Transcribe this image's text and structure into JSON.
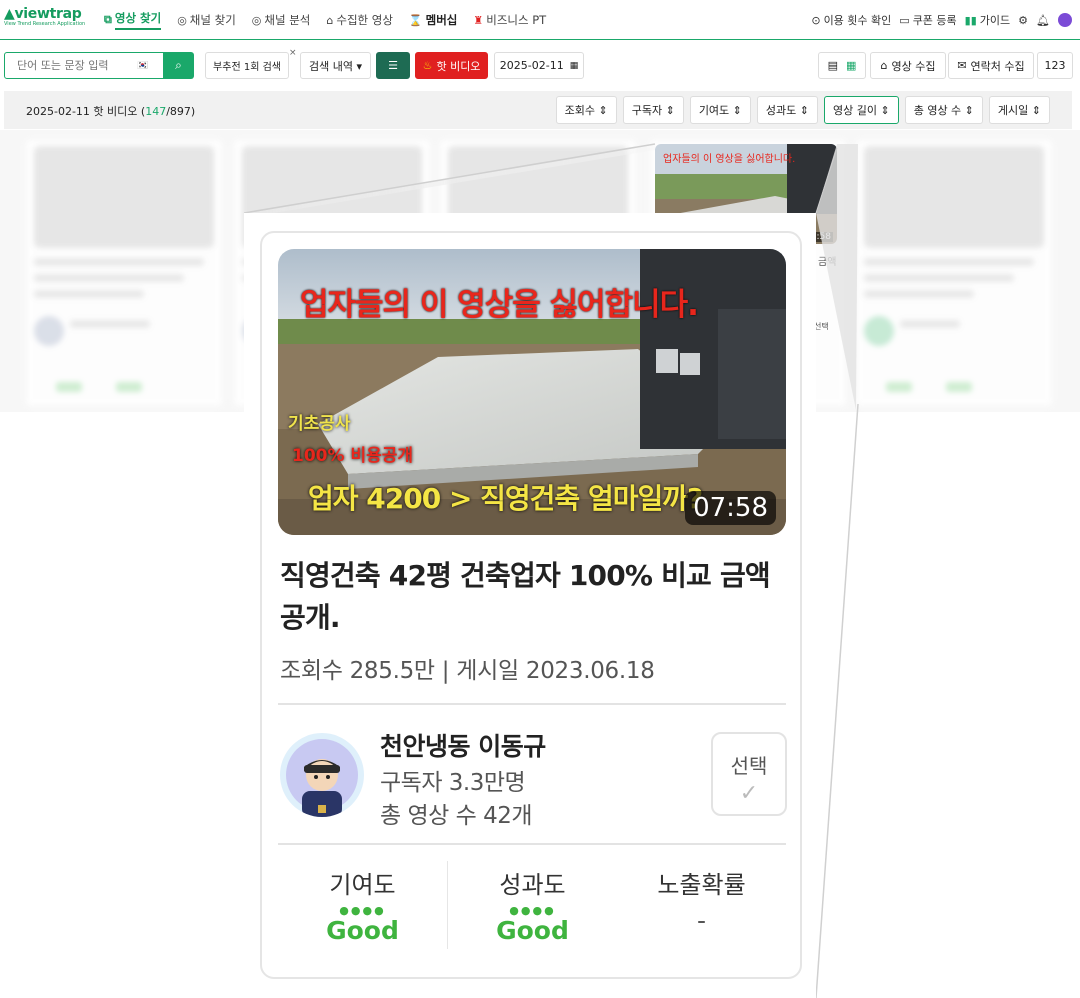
{
  "app": {
    "logo": "viewtrap",
    "logo_sub": "View Trend Research Application"
  },
  "nav": {
    "items": [
      {
        "label": "영상 찾기",
        "icon": "video-search-icon"
      },
      {
        "label": "채널 찾기",
        "icon": "channel-search-icon"
      },
      {
        "label": "채널 분석",
        "icon": "channel-analysis-icon"
      },
      {
        "label": "수집한 영상",
        "icon": "folder-icon"
      },
      {
        "label": "멤버십",
        "icon": "membership-icon"
      },
      {
        "label": "비즈니스 PT",
        "icon": "business-icon"
      }
    ],
    "right": {
      "usage": "이용 횟수 확인",
      "coupon": "쿠폰 등록",
      "guide": "가이드"
    }
  },
  "toolbar": {
    "search_placeholder": "단어 또는 문장 입력",
    "recommend": "부추전 1회 검색",
    "history": "검색 내역 ▾",
    "hot_video": "핫 비디오",
    "date": "2025-02-11",
    "collect_video": "영상 수집",
    "collect_contact": "연락처 수집",
    "count": "123"
  },
  "sortbar": {
    "title_prefix": "2025-02-11 핫 비디오 (",
    "count_green": "147",
    "title_suffix": "/897)",
    "buttons": [
      "조회수",
      "구독자",
      "기여도",
      "성과도",
      "영상 길이",
      "총 영상 수",
      "게시일"
    ]
  },
  "card": {
    "thumb_text_top": "업자들의 이 영상을 싫어합니다.",
    "thumb_text_mid1": "기초공사",
    "thumb_text_mid2": "100% 비용공개",
    "thumb_text_bottom": "업자 4200 > 직영건축 얼마일까?",
    "duration": "07:58",
    "title": "직영건축 42평 건축업자 100% 비교 금액 공개.",
    "meta": "조회수 285.5만 | 게시일 2023.06.18",
    "channel_name": "천안냉동 이동규",
    "subscribers": "구독자 3.3만명",
    "video_count": "총 영상 수 42개",
    "select_label": "선택",
    "metrics": [
      {
        "label": "기여도",
        "value": "Good"
      },
      {
        "label": "성과도",
        "value": "Good"
      },
      {
        "label": "노출확률",
        "value": "-"
      }
    ]
  },
  "background": {
    "small_thumb_duration": "7:58",
    "side_text_1": "금액",
    "side_text_2": "선택"
  },
  "colors": {
    "brand": "#1aa86a",
    "hot": "#e02020",
    "good": "#3fb43f"
  }
}
